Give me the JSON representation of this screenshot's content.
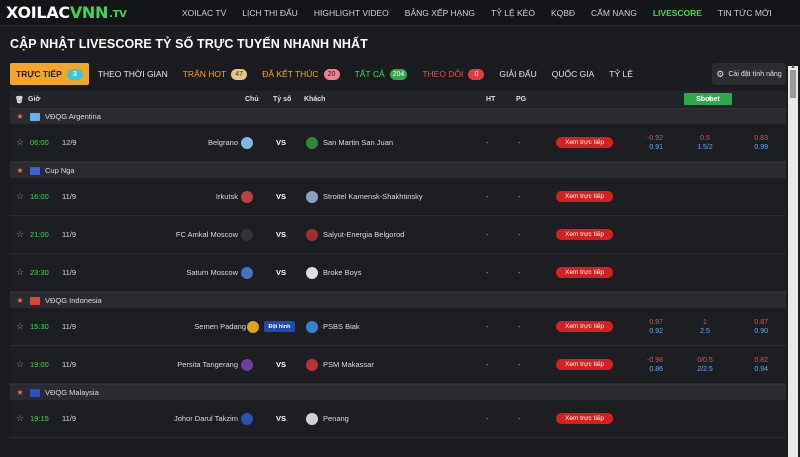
{
  "logo": {
    "a": "XOILAC",
    "b": "VNN",
    "c": ".TV"
  },
  "nav": [
    "XOILAC TV",
    "LỊCH THI ĐẤU",
    "HIGHLIGHT VIDEO",
    "BẢNG XẾP HẠNG",
    "TỶ LỆ KÈO",
    "KQBĐ",
    "CẨM NANG",
    "LIVESCORE",
    "TIN TỨC MỚI"
  ],
  "heading": "CẬP NHẬT LIVESCORE TỶ SỐ TRỰC TUYẾN NHANH NHẤT",
  "filters": {
    "live": "TRỰC TIẾP",
    "live_count": "3",
    "schedule": "THEO THỜI GIAN",
    "hot": "TRẬN HOT",
    "hot_count": "47",
    "done": "ĐÃ KẾT THÚC",
    "done_count": "20",
    "all": "TẤT CẢ",
    "all_count": "204",
    "follow": "THEO DÕI",
    "follow_count": "0",
    "league": "GIẢI ĐẤU",
    "country": "QUỐC GIA",
    "odds": "TỶ LỆ"
  },
  "settings": "Cài đặt tính năng",
  "thead": {
    "gio": "Giờ",
    "chu": "Chủ",
    "tyso": "Tỷ số",
    "khach": "Khách",
    "ht": "HT",
    "pg": "PG",
    "sbo": "Sbobet"
  },
  "watch_label": "Xem trực tiếp",
  "leagues": [
    {
      "name": "VĐQG Argentina",
      "flag": "#6fb0e8"
    },
    {
      "name": "Cup Nga",
      "flag": "#4060d0"
    },
    {
      "name": "VĐQG Indonesia",
      "flag": "#e04040"
    },
    {
      "name": "VĐQG Malaysia",
      "flag": "#3050c0"
    }
  ],
  "matches": [
    {
      "time": "06:00",
      "date": "12/9",
      "home": "Belgrano",
      "vs": "VS",
      "away": "San Martin San Juan",
      "ht": "-",
      "pg": "-",
      "o1t": "-0.92",
      "o1b": "0.91",
      "o2t": "0.5",
      "o2b": "1.5/2",
      "o3t": "0.83",
      "o3b": "0.99",
      "hc": "#7ab8e0",
      "ac": "#2a8a3a"
    },
    {
      "time": "16:00",
      "date": "11/9",
      "home": "Irkutsk",
      "vs": "VS",
      "away": "Stroitel Kamensk-Shakhtinsky",
      "ht": "-",
      "pg": "-",
      "hc": "#c04040",
      "ac": "#8aa0c0"
    },
    {
      "time": "21:00",
      "date": "11/9",
      "home": "FC Amkal Moscow",
      "vs": "VS",
      "away": "Salyut-Energia Belgorod",
      "ht": "-",
      "pg": "-",
      "hc": "#333333",
      "ac": "#a03030"
    },
    {
      "time": "23:30",
      "date": "11/9",
      "home": "Saturn Moscow",
      "vs": "VS",
      "away": "Broke Boys",
      "ht": "-",
      "pg": "-",
      "hc": "#4a70c0",
      "ac": "#dddddd"
    },
    {
      "time": "15:30",
      "date": "11/9",
      "home": "Semen Padang",
      "vs": "VS",
      "tag": "Đội hình",
      "away": "PSBS Biak",
      "ht": "-",
      "pg": "-",
      "o1t": "0.97",
      "o1b": "0.92",
      "o2t": "1",
      "o2b": "2.5",
      "o3t": "0.87",
      "o3b": "0.90",
      "hc": "#e0a020",
      "ac": "#3a80d0"
    },
    {
      "time": "19:00",
      "date": "11/9",
      "home": "Persita Tangerang",
      "vs": "VS",
      "away": "PSM Makassar",
      "ht": "-",
      "pg": "-",
      "o1t": "-0.98",
      "o1b": "0.86",
      "o2t": "0/0.5",
      "o2b": "2/2.5",
      "o3t": "0.82",
      "o3b": "0.94",
      "hc": "#6a40a0",
      "ac": "#c03030"
    },
    {
      "time": "19:15",
      "date": "11/9",
      "home": "Johor Darul Takzim",
      "vs": "VS",
      "away": "Penang",
      "ht": "-",
      "pg": "-",
      "hc": "#3050b0",
      "ac": "#d0d0d0"
    }
  ]
}
